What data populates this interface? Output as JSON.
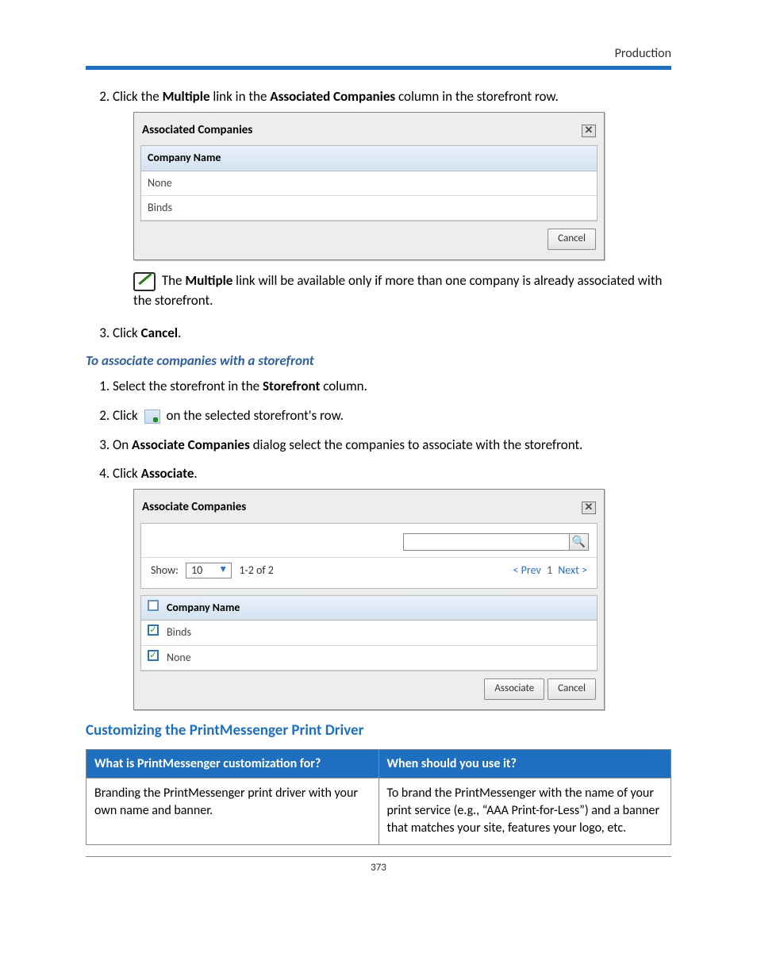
{
  "header": {
    "section": "Production"
  },
  "page_number": "373",
  "step2": {
    "num": "2.",
    "pre": "Click the ",
    "bold1": "Multiple",
    "mid": " link in the ",
    "bold2": "Associated Companies",
    "post": " column in the storefront row."
  },
  "dialog1": {
    "title": "Associated Companies",
    "header": "Company Name",
    "rows": [
      "None",
      "Binds"
    ],
    "cancel": "Cancel"
  },
  "note": {
    "pre": "The ",
    "bold": "Multiple",
    "post": " link will be available only if more than one company is already associated with the storefront."
  },
  "step3": {
    "pre": "Click ",
    "bold": "Cancel",
    "post": "."
  },
  "subheading": "To associate companies with a storefront",
  "assoc_steps": {
    "s1": {
      "pre": "Select the storefront in the ",
      "bold": "Storefront",
      "post": " column."
    },
    "s2": {
      "pre": "Click ",
      "post": " on the selected storefront's row."
    },
    "s3": {
      "pre": "On ",
      "bold": "Associate Companies",
      "post": " dialog select the companies to associate with the storefront."
    },
    "s4": {
      "pre": "Click ",
      "bold": "Associate",
      "post": "."
    }
  },
  "dialog2": {
    "title": "Associate Companies",
    "show_label": "Show:",
    "show_value": "10",
    "range": "1-2 of 2",
    "prev": "< Prev",
    "page": "1",
    "next": "Next >",
    "header": "Company Name",
    "rows": [
      "Binds",
      "None"
    ],
    "associate": "Associate",
    "cancel": "Cancel"
  },
  "section_heading": "Customizing the PrintMessenger Print Driver",
  "table": {
    "h1": "What is PrintMessenger customization for?",
    "h2": "When should you use it?",
    "c1": "Branding the PrintMessenger print driver with your own name and banner.",
    "c2": "To brand the PrintMessenger with the name of your print service (e.g., “AAA Print-for-Less”) and a banner that matches your site, features your logo, etc."
  }
}
